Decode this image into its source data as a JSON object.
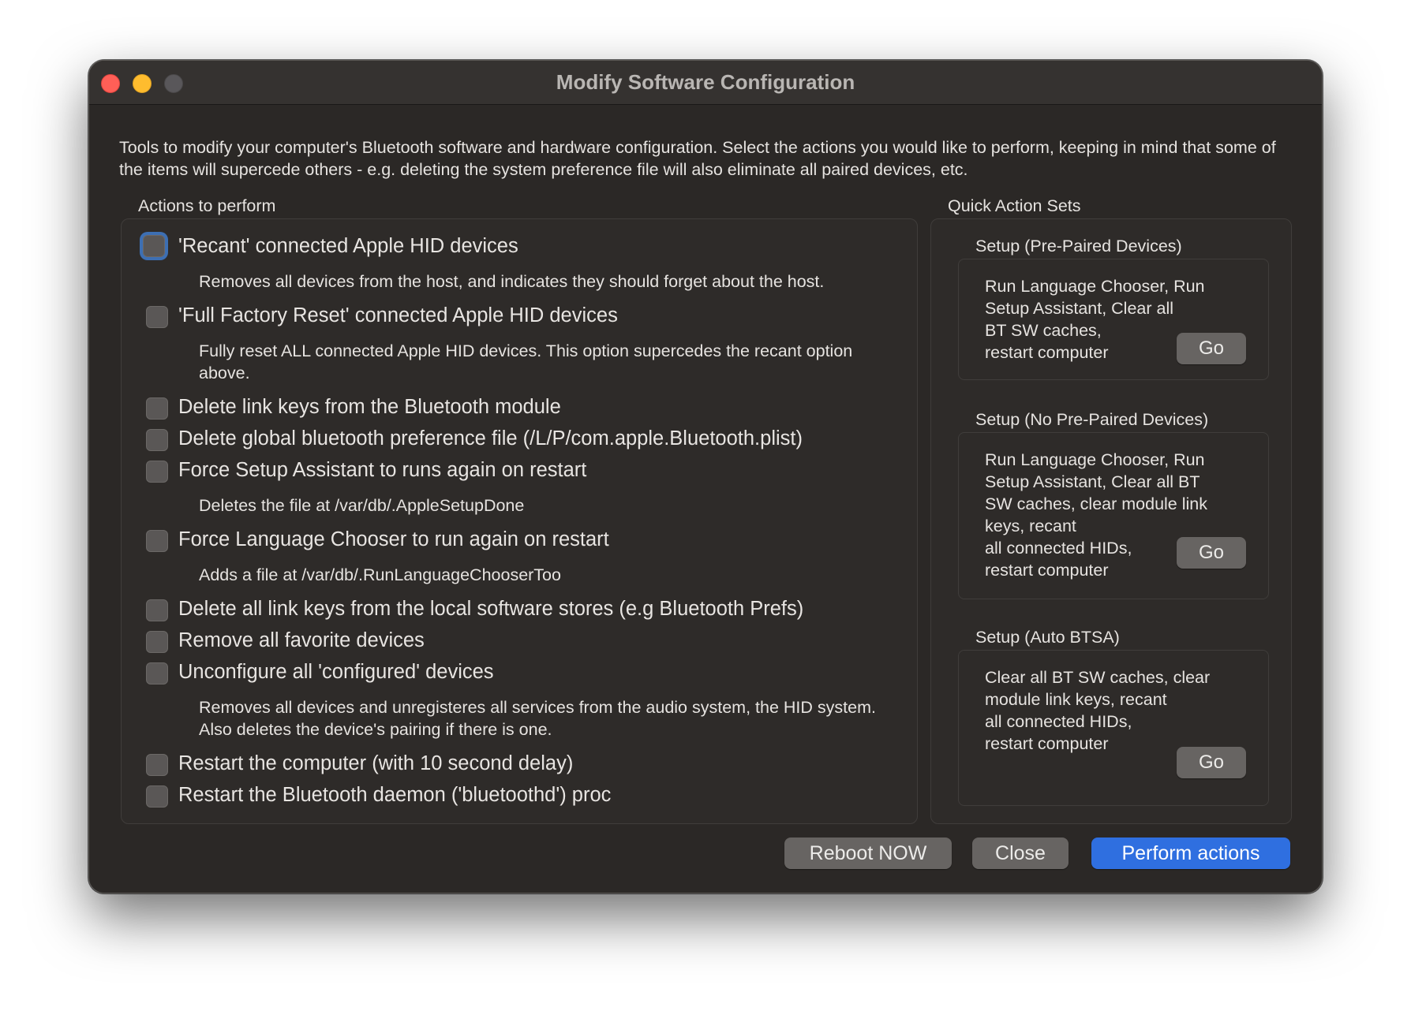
{
  "window": {
    "title": "Modify Software Configuration",
    "intro": "Tools to modify your computer's Bluetooth software and hardware configuration. Select the actions you would like to perform, keeping in mind that some of the items will supercede others - e.g. deleting the system preference file will also eliminate all paired devices, etc."
  },
  "actions": {
    "label": "Actions to perform",
    "items": [
      {
        "label": "'Recant' connected Apple HID devices",
        "desc": "Removes all devices from the host, and indicates they should forget about the host."
      },
      {
        "label": "'Full Factory Reset' connected Apple HID devices",
        "desc": "Fully reset ALL connected Apple HID devices. This option supercedes the recant option above."
      },
      {
        "label": "Delete link keys from the Bluetooth module"
      },
      {
        "label": "Delete global bluetooth preference file (/L/P/com.apple.Bluetooth.plist)"
      },
      {
        "label": "Force Setup Assistant to runs again on restart",
        "desc": "Deletes the file at /var/db/.AppleSetupDone"
      },
      {
        "label": "Force Language Chooser to run again on restart",
        "desc": "Adds a file at /var/db/.RunLanguageChooserToo"
      },
      {
        "label": "Delete all link keys from the local software stores (e.g Bluetooth Prefs)"
      },
      {
        "label": "Remove all favorite devices"
      },
      {
        "label": "Unconfigure all 'configured' devices",
        "desc": "Removes all devices and unregisteres all services from the audio system, the HID system. Also deletes the device's pairing if there is one."
      },
      {
        "label": "Restart the computer (with 10 second delay)"
      },
      {
        "label": "Restart the Bluetooth daemon ('bluetoothd') proc"
      }
    ]
  },
  "quick_sets": {
    "label": "Quick Action Sets",
    "sets": [
      {
        "title": "Setup (Pre-Paired Devices)",
        "lines": [
          "Run Language Chooser, Run",
          "Setup Assistant, Clear all",
          "BT SW caches,",
          "restart computer"
        ],
        "go": "Go"
      },
      {
        "title": "Setup (No Pre-Paired Devices)",
        "lines": [
          "Run Language Chooser, Run",
          "Setup Assistant, Clear all BT",
          "SW caches, clear module link",
          "keys, recant",
          "all connected HIDs,",
          "restart computer"
        ],
        "go": "Go"
      },
      {
        "title": "Setup (Auto BTSA)",
        "lines": [
          "Clear all BT SW caches, clear",
          "module link keys, recant",
          "all connected HIDs,",
          "restart computer"
        ],
        "go": "Go"
      }
    ]
  },
  "footer": {
    "reboot": "Reboot NOW",
    "close": "Close",
    "perform": "Perform actions"
  },
  "colors": {
    "accent": "#2f6fe0",
    "window_bg": "#2b2826"
  }
}
